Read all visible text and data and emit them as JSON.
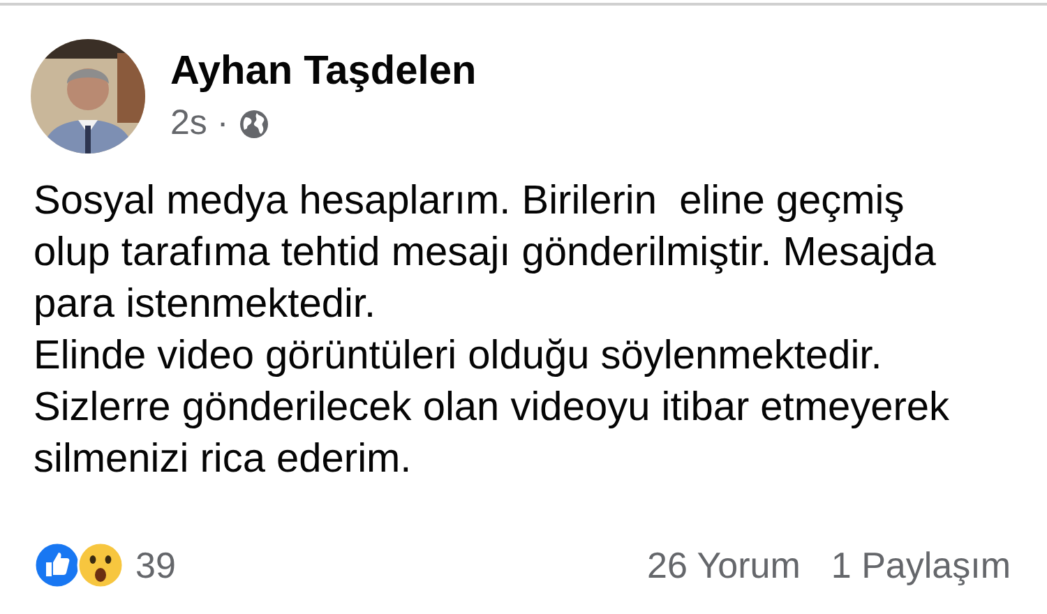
{
  "post": {
    "author": "Ayhan Taşdelen",
    "time": "2s",
    "separator": "·",
    "text_lines": [
      "Sosyal medya hesaplarım. Birilerin  eline geçmiş",
      "olup tarafıma tehtid mesajı gönderilmiştir. Mesajda",
      "para istenmektedir.",
      "Elinde video görüntüleri olduğu söylenmektedir.",
      "Sizlerre gönderilecek olan videoyu itibar etmeyerek",
      "silmenizi rica ederim."
    ],
    "reactions": {
      "icons": [
        {
          "kind": "like"
        },
        {
          "kind": "wow"
        }
      ],
      "count": "39"
    },
    "comments": "26 Yorum",
    "shares": "1 Paylaşım"
  }
}
